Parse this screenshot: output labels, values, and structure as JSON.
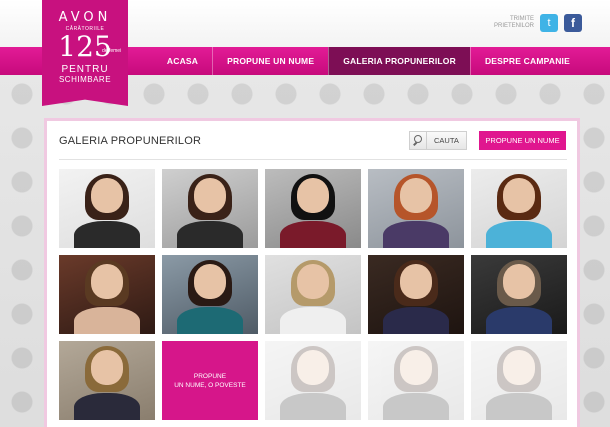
{
  "logo": {
    "brand": "AVON",
    "sub": "CÂRĂTORIILE",
    "number": "125",
    "small": "de femei",
    "pentru": "PENTRU",
    "schimbare": "SCHIMBARE"
  },
  "share": {
    "text_line1": "TRIMITE",
    "text_line2": "PRIETENILOR",
    "twitter_glyph": "t",
    "facebook_glyph": "f"
  },
  "nav": {
    "items": [
      {
        "label": "ACASA"
      },
      {
        "label": "PROPUNE UN NUME"
      },
      {
        "label": "GALERIA PROPUNERILOR"
      },
      {
        "label": "DESPRE CAMPANIE"
      }
    ]
  },
  "panel": {
    "title": "GALERIA PROPUNERILOR",
    "search_label": "CAUTA",
    "propose_label": "PROPUNE UN NUME"
  },
  "cta_tile": {
    "line1": "PROPUNE",
    "line2": "UN NUME, O POVESTE"
  },
  "colors": {
    "brand_pink": "#e0168f",
    "nav_active": "#7d0e55"
  }
}
